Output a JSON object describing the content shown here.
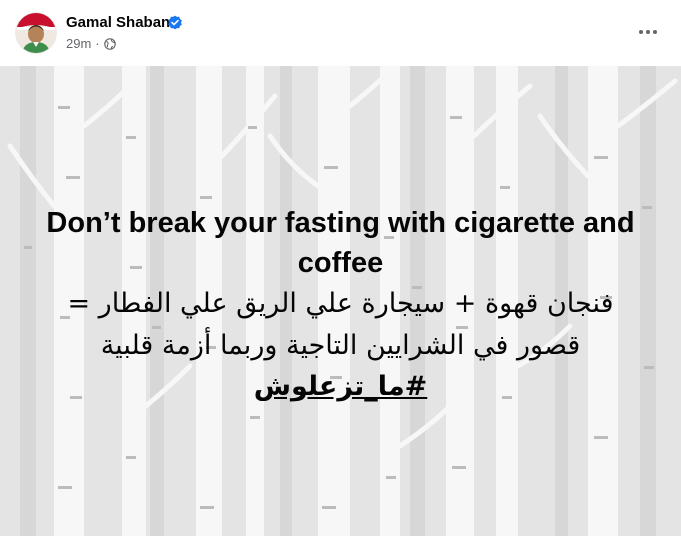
{
  "post": {
    "author": {
      "name": "Gamal Shaban",
      "verified": true,
      "avatar_icon": "profile-photo"
    },
    "meta": {
      "time": "29m",
      "separator": "·",
      "audience_icon": "globe-icon"
    },
    "more_icon": "more-horizontal-icon",
    "content": {
      "headline_line1": "Don’t break your fasting with cigarette and",
      "headline_line2": "coffee",
      "arabic_line1": "فنجان قهوة + سيجارة علي الريق علي الفطار =",
      "arabic_line2": "قصور في الشرايين التاجية وربما أزمة قلبية",
      "hashtag": "#ما_تزعلوش"
    },
    "colors": {
      "text": "#050505",
      "meta_text": "#65676b",
      "verified_blue": "#1877f2",
      "card_background": "#e4e4e4",
      "tree_color": "#ffffff"
    }
  }
}
